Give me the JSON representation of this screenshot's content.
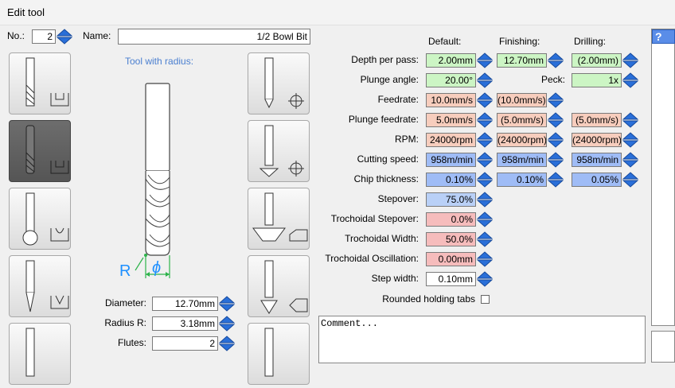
{
  "window": {
    "title": "Edit tool"
  },
  "header": {
    "no_label": "No.:",
    "no_value": "2",
    "name_label": "Name:",
    "name_value": "1/2 Bowl Bit"
  },
  "preview": {
    "title": "Tool with radius:",
    "r_label": "R",
    "phi_label": "ϕ"
  },
  "dims": {
    "diameter_label": "Diameter:",
    "diameter_value": "12.70mm",
    "radius_label": "Radius R:",
    "radius_value": "3.18mm",
    "flutes_label": "Flutes:",
    "flutes_value": "2"
  },
  "columns": {
    "default": "Default:",
    "finishing": "Finishing:",
    "drilling": "Drilling:"
  },
  "params": {
    "depth_label": "Depth per pass:",
    "depth_default": "2.00mm",
    "depth_finishing": "12.70mm",
    "depth_drilling": "(2.00mm)",
    "plunge_angle_label": "Plunge angle:",
    "plunge_angle_default": "20.00°",
    "peck_label": "Peck:",
    "peck_drilling": "1x",
    "feedrate_label": "Feedrate:",
    "feedrate_default": "10.0mm/s",
    "feedrate_finishing": "(10.0mm/s)",
    "plunge_feed_label": "Plunge feedrate:",
    "plunge_feed_default": "5.0mm/s",
    "plunge_feed_finishing": "(5.0mm/s)",
    "plunge_feed_drilling": "(5.0mm/s)",
    "rpm_label": "RPM:",
    "rpm_default": "24000rpm",
    "rpm_finishing": "(24000rpm)",
    "rpm_drilling": "(24000rpm)",
    "cutting_label": "Cutting speed:",
    "cutting_default": "958m/min",
    "cutting_finishing": "958m/min",
    "cutting_drilling": "958m/min",
    "chip_label": "Chip thickness:",
    "chip_default": "0.10%",
    "chip_finishing": "0.10%",
    "chip_drilling": "0.05%",
    "stepover_label": "Stepover:",
    "stepover_default": "75.0%",
    "troch_stepover_label": "Trochoidal Stepover:",
    "troch_stepover_default": "0.0%",
    "troch_width_label": "Trochoidal Width:",
    "troch_width_default": "50.0%",
    "troch_osc_label": "Trochoidal Oscillation:",
    "troch_osc_default": "0.00mm",
    "step_width_label": "Step width:",
    "step_width_default": "0.10mm",
    "tabs_label": "Rounded holding tabs"
  },
  "comment": {
    "placeholder": "Comment..."
  },
  "help": {
    "label": "?"
  },
  "colors": {
    "green": "#ccf5c4",
    "salmon": "#f7cdbd",
    "blue": "#9fbcf6",
    "pink": "#f6bcbc",
    "accent": "#4a7fd0"
  }
}
